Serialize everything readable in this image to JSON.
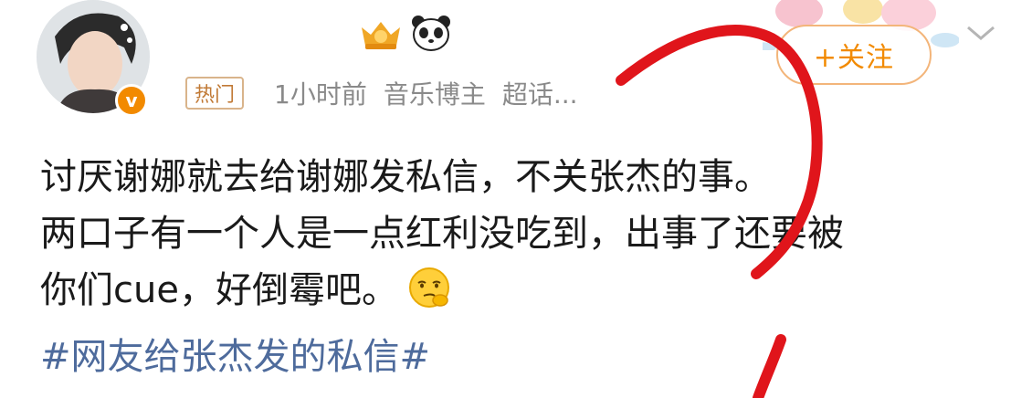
{
  "header": {
    "follow_label": "+关注",
    "hot_tag": "热门",
    "time": "1小时前",
    "category": "音乐博主",
    "super_topic": "超话..."
  },
  "icons": [
    "avatar",
    "verified-icon",
    "crown-badge-icon",
    "panda-icon",
    "chevron-down-icon",
    "thinking-face-emoji"
  ],
  "colors": {
    "accent": "#f28a00",
    "topic": "#4e6b9c",
    "annotation": "#e0151b"
  },
  "post": {
    "line1": "讨厌谢娜就去给谢娜发私信，不关张杰的事。",
    "line2": "两口子有一个人是一点红利没吃到，出事了还要被",
    "line3": "你们cue，好倒霉吧。",
    "topic": "#网友给张杰发的私信#"
  }
}
